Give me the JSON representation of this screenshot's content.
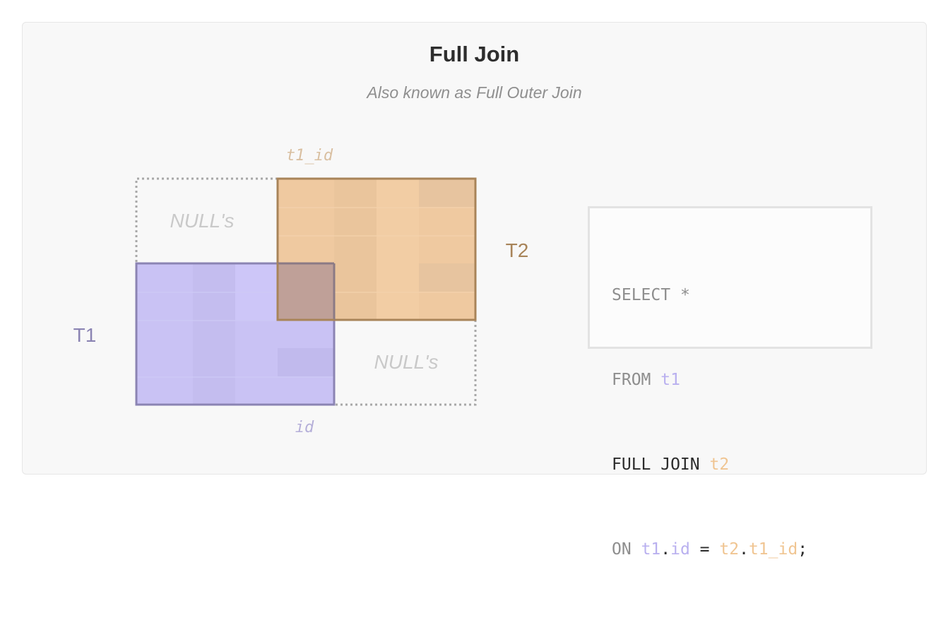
{
  "title": "Full Join",
  "subtitle": "Also known as Full Outer Join",
  "diagram": {
    "t1_label": "T1",
    "t2_label": "T2",
    "t1_key_label": "id",
    "t2_key_label": "t1_id",
    "null_label_top": "NULL's",
    "null_label_bottom": "NULL's"
  },
  "sql": {
    "line1": [
      "SELECT",
      " ",
      "*"
    ],
    "line2": [
      "FROM",
      " ",
      "t1"
    ],
    "line3": [
      "FULL JOIN",
      " ",
      "t2"
    ],
    "line4": [
      "ON",
      " ",
      "t1",
      ".",
      "id",
      " = ",
      "t2",
      ".",
      "t1_id",
      ";"
    ]
  },
  "colors": {
    "t1_fill": "#c9c2f4",
    "t1_border": "#8b84b3",
    "t2_fill": "#efc9a0",
    "t2_border": "#a88459",
    "overlap_fill": "#bfa098",
    "null_border": "#a8a8a8"
  }
}
